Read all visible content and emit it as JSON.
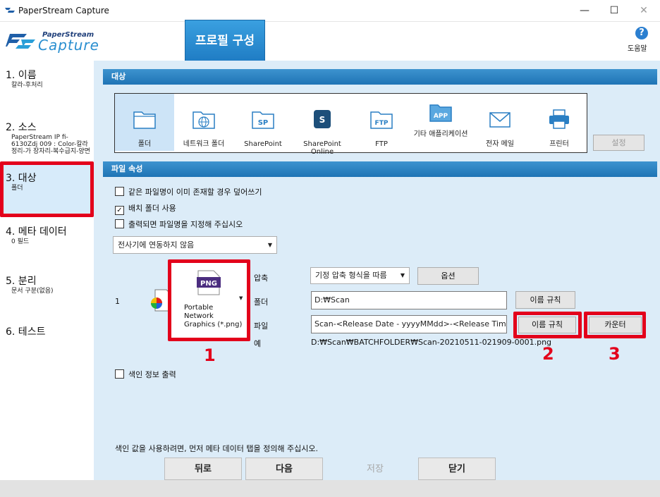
{
  "window": {
    "title": "PaperStream Capture",
    "minimize": "—",
    "maximize": "☐",
    "close": "✕"
  },
  "header": {
    "logo_top": "PaperStream",
    "logo_bottom": "Capture",
    "profile_tab": "프로필 구성",
    "help_label": "도움말",
    "help_icon": "?"
  },
  "sidebar": {
    "items": [
      {
        "title": "1. 이름",
        "sub": "칼라-후처리"
      },
      {
        "title": "2. 소스",
        "sub": "PaperStream IP fi-6130Zdj 009 : Color-칼라정리-가 장자리-복수급지-양면"
      },
      {
        "title": "3. 대상",
        "sub": "폴더"
      },
      {
        "title": "4. 메타 데이터",
        "sub": "0 필드"
      },
      {
        "title": "5. 분리",
        "sub": "문서 구분(없음)"
      },
      {
        "title": "6. 테스트",
        "sub": ""
      }
    ]
  },
  "destination": {
    "section_title": "대상",
    "settings_button": "설정",
    "items": [
      {
        "label": "폴더",
        "icon": "folder-icon"
      },
      {
        "label": "네트워크 폴더",
        "icon": "network-folder-icon"
      },
      {
        "label": "SharePoint",
        "icon": "sharepoint-icon"
      },
      {
        "label": "SharePoint Online",
        "icon": "sharepoint-online-icon"
      },
      {
        "label": "FTP",
        "icon": "ftp-icon"
      },
      {
        "label": "기타 애플리케이션",
        "icon": "app-icon"
      },
      {
        "label": "전자 메일",
        "icon": "mail-icon"
      },
      {
        "label": "프린터",
        "icon": "printer-icon"
      }
    ]
  },
  "file_props": {
    "section_title": "파일 속성",
    "overwrite": "같은 파일명이 이미 존재할 경우 덮어쓰기",
    "batch_folder": "배치 폴더 사용",
    "name_on_output": "출력되면 파일명을 지정해 주십시오",
    "link_combo": "전사기에 연동하지 않음",
    "row_index": "1",
    "format_icon_text": "PNG",
    "format_label": "Portable Network Graphics (*.png)",
    "compress_label": "압축",
    "compress_value": "기정 압축 형식을 따름",
    "option_button": "옵션",
    "folder_label": "폴더",
    "folder_value": "D:₩Scan",
    "folder_name_rule": "이름 규칙",
    "file_label": "파일",
    "file_value": "Scan-<Release Date - yyyyMMdd>-<Release Time (HH",
    "file_name_rule": "이름 규칙",
    "counter_button": "카운터",
    "example_label": "예",
    "example_value": "D:₩Scan₩BATCHFOLDER₩Scan-20210511-021909-0001.png",
    "index_output": "색인 정보 출력",
    "note": "색인 값을 사용하려면, 먼저 메타 데이터 탭을 정의해 주십시오."
  },
  "callouts": {
    "one": "1",
    "two": "2",
    "three": "3"
  },
  "nav": {
    "back": "뒤로",
    "next": "다음",
    "save": "저장",
    "close": "닫기"
  },
  "colors": {
    "accent": "#1f7cc4",
    "panel": "#dcecf8",
    "callout": "#e3001b"
  }
}
